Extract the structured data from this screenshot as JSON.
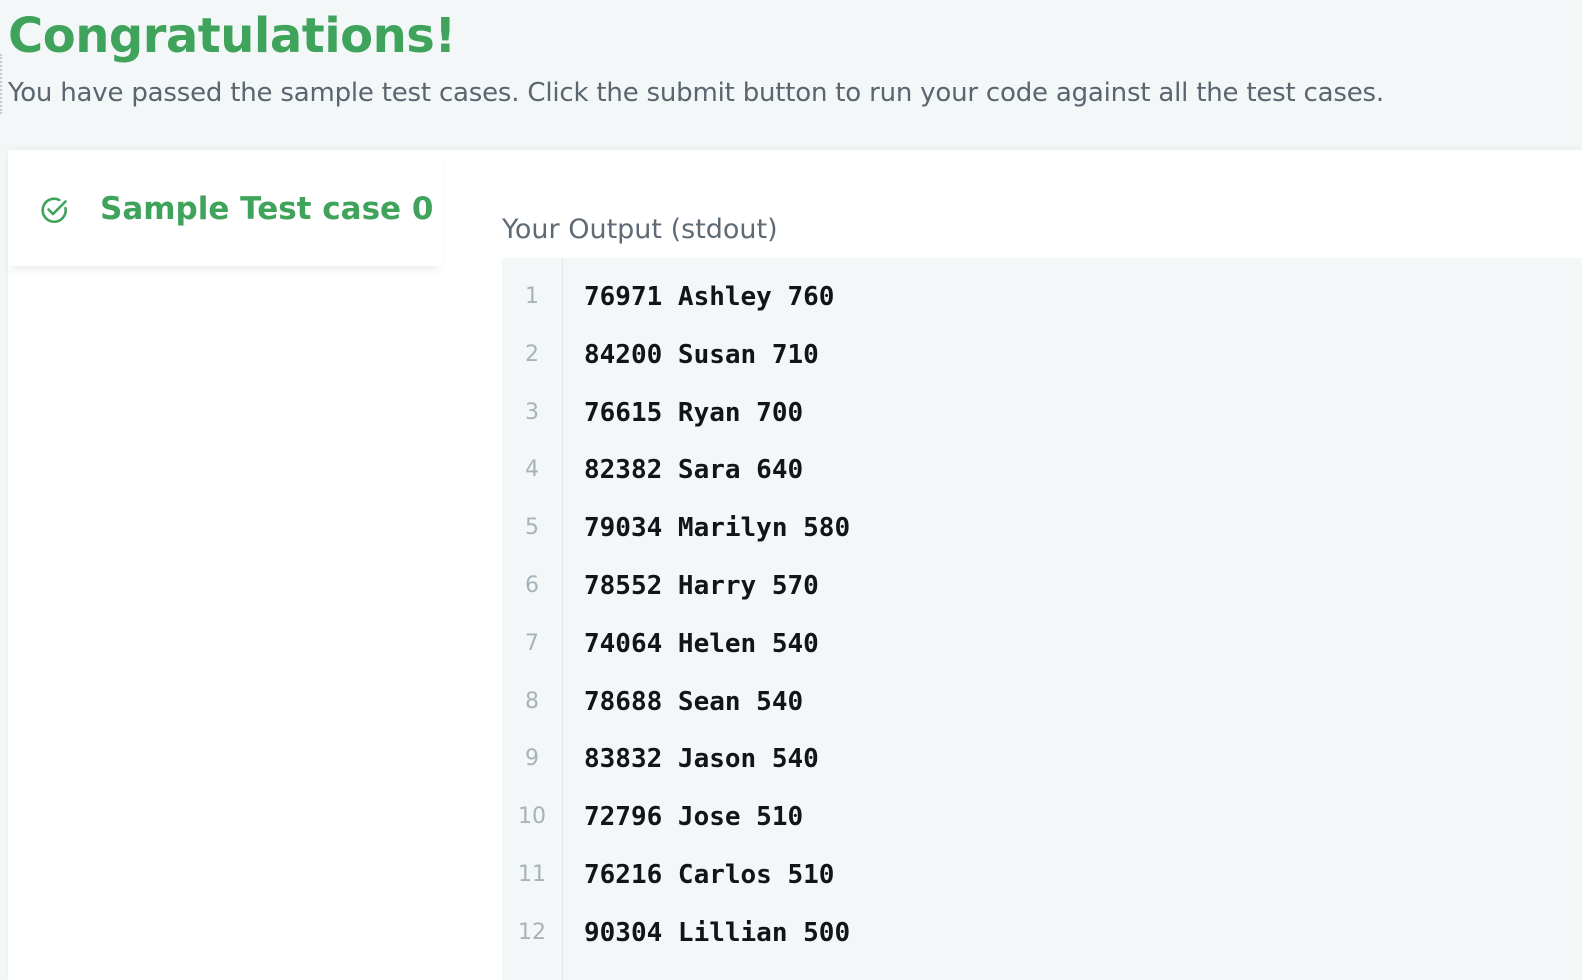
{
  "header": {
    "title": "Congratulations!",
    "subtitle": "You have passed the sample test cases. Click the submit button to run your code against all the test cases."
  },
  "tabs": [
    {
      "label": "Sample Test case 0",
      "icon": "check-circle-icon",
      "status": "passed",
      "selected": true
    }
  ],
  "output": {
    "label": "Your Output (stdout)",
    "lines": [
      {
        "num": "1",
        "text": "76971 Ashley 760"
      },
      {
        "num": "2",
        "text": "84200 Susan 710"
      },
      {
        "num": "3",
        "text": "76615 Ryan 700"
      },
      {
        "num": "4",
        "text": "82382 Sara 640"
      },
      {
        "num": "5",
        "text": "79034 Marilyn 580"
      },
      {
        "num": "6",
        "text": "78552 Harry 570"
      },
      {
        "num": "7",
        "text": "74064 Helen 540"
      },
      {
        "num": "8",
        "text": "78688 Sean 540"
      },
      {
        "num": "9",
        "text": "83832 Jason 540"
      },
      {
        "num": "10",
        "text": "72796 Jose 510"
      },
      {
        "num": "11",
        "text": "76216 Carlos 510"
      },
      {
        "num": "12",
        "text": "90304 Lillian 500"
      }
    ]
  },
  "colors": {
    "success_green": "#3fa35b",
    "page_background": "#f3f7f7",
    "muted_text": "#5a6570",
    "line_number": "#a7b2b9"
  }
}
